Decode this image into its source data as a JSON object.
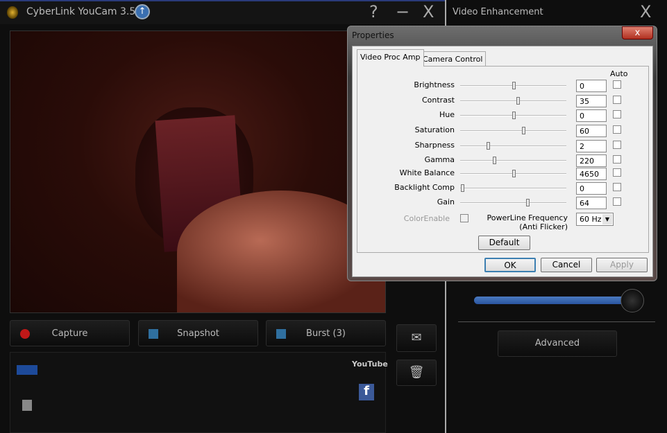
{
  "app": {
    "title": "CyberLink YouCam 3.5",
    "help": "?",
    "minimize": "−",
    "close": "X"
  },
  "buttons": {
    "capture": "Capture",
    "snapshot": "Snapshot",
    "burst": "Burst (3)"
  },
  "share": {
    "youtube": "YouTube",
    "facebook": "f"
  },
  "enhancement": {
    "title": "Video Enhancement",
    "close": "X",
    "advanced": "Advanced",
    "slider_level": 0.95
  },
  "dialog": {
    "title": "Properties",
    "close": "x",
    "tabs": [
      {
        "label": "Video Proc Amp",
        "active": true
      },
      {
        "label": "Camera Control",
        "active": false
      }
    ],
    "auto_label": "Auto",
    "settings": [
      {
        "label": "Brightness",
        "value": "0",
        "slider_level": 0.51,
        "auto": false
      },
      {
        "label": "Contrast",
        "value": "35",
        "slider_level": 0.55,
        "auto": false
      },
      {
        "label": "Hue",
        "value": "0",
        "slider_level": 0.51,
        "auto": false
      },
      {
        "label": "Saturation",
        "value": "60",
        "slider_level": 0.6,
        "auto": false
      },
      {
        "label": "Sharpness",
        "value": "2",
        "slider_level": 0.26,
        "auto": false
      },
      {
        "label": "Gamma",
        "value": "220",
        "slider_level": 0.32,
        "auto": false
      },
      {
        "label": "White Balance",
        "value": "4650",
        "slider_level": 0.51,
        "auto": false
      },
      {
        "label": "Backlight Comp",
        "value": "0",
        "slider_level": 0.01,
        "auto": false
      },
      {
        "label": "Gain",
        "value": "64",
        "slider_level": 0.64,
        "auto": false
      }
    ],
    "color_enable": "ColorEnable",
    "powerline_label": "PowerLine Frequency",
    "powerline_sub": "(Anti Flicker)",
    "powerline_value": "60 Hz",
    "default": "Default",
    "ok": "OK",
    "cancel": "Cancel",
    "apply": "Apply"
  }
}
